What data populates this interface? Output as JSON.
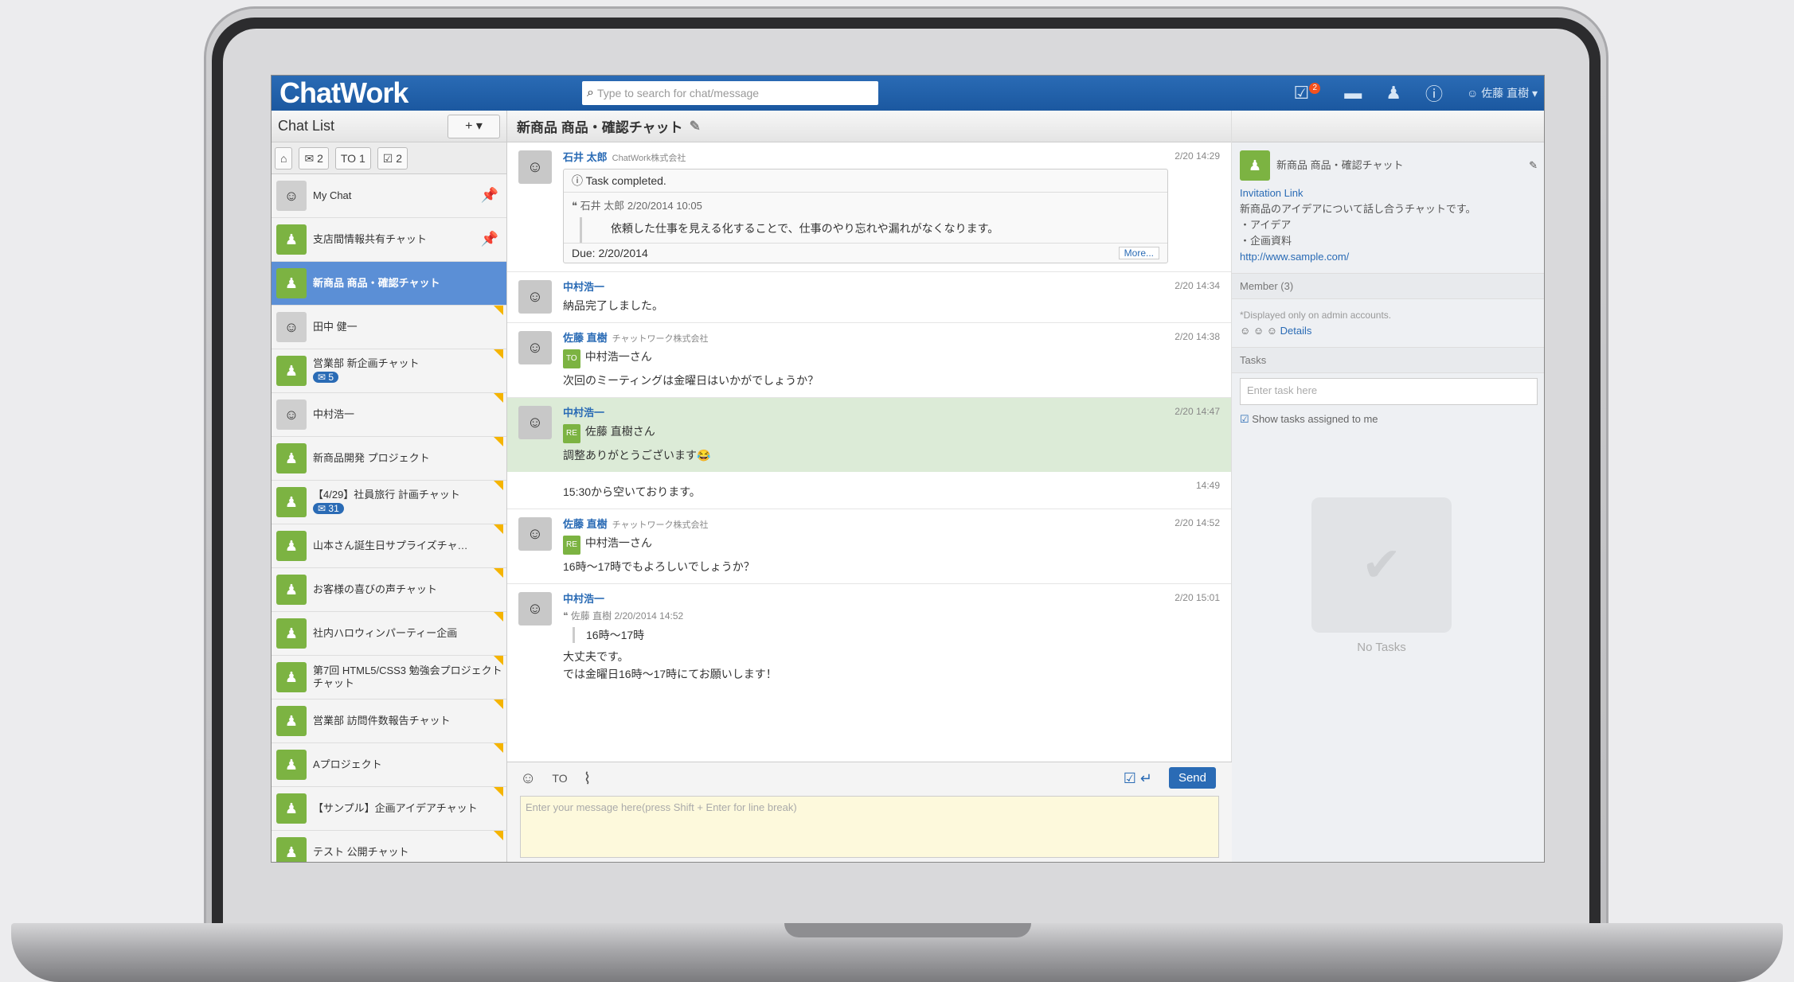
{
  "app": {
    "logo": "ChatWork"
  },
  "search": {
    "placeholder": "Type to search for chat/message"
  },
  "topbar": {
    "user_name": "佐藤 直樹"
  },
  "chat_list": {
    "title": "Chat List",
    "add_label": "+ ▾",
    "filters": [
      "⌂",
      "✉ 2",
      "TO 1",
      "☑ 2"
    ],
    "rooms": [
      {
        "name": "My Chat",
        "type": "person",
        "pinned": true
      },
      {
        "name": "支店間情報共有チャット",
        "type": "group",
        "pinned": true
      },
      {
        "name": "新商品 商品・確認チャット",
        "type": "group",
        "active": true
      },
      {
        "name": "田中 健一",
        "type": "person"
      },
      {
        "name": "営業部 新企画チャット",
        "type": "group",
        "unread": "✉ 5"
      },
      {
        "name": "中村浩一",
        "type": "person"
      },
      {
        "name": "新商品開発 プロジェクト",
        "type": "group"
      },
      {
        "name": "【4/29】社員旅行 計画チャット",
        "type": "group",
        "unread": "✉ 31"
      },
      {
        "name": "山本さん誕生日サプライズチャ…",
        "type": "group"
      },
      {
        "name": "お客様の喜びの声チャット",
        "type": "group"
      },
      {
        "name": "社内ハロウィンパーティー企画",
        "type": "group"
      },
      {
        "name": "第7回 HTML5/CSS3 勉強会プロジェクトチャット",
        "type": "group"
      },
      {
        "name": "営業部 訪問件数報告チャット",
        "type": "group"
      },
      {
        "name": "Aプロジェクト",
        "type": "group"
      },
      {
        "name": "【サンプル】企画アイデアチャット",
        "type": "group"
      },
      {
        "name": "テスト 公開チャット",
        "type": "group"
      }
    ]
  },
  "room": {
    "title": "新商品 商品・確認チャット"
  },
  "messages": [
    {
      "sender": "石井 太郎",
      "org": "ChatWork株式会社",
      "time": "2/20 14:29",
      "task_status": "ⓘ Task completed.",
      "quote_meta": "石井 太郎 2/20/2014 10:05",
      "quote_text": "依頼した仕事を見える化することで、仕事のやり忘れや漏れがなくなります。",
      "due": "Due: 2/20/2014",
      "more": "More..."
    },
    {
      "sender": "中村浩一",
      "org": "",
      "time": "2/20 14:34",
      "text": "納品完了しました。"
    },
    {
      "sender": "佐藤 直樹",
      "org": "チャットワーク株式会社",
      "time": "2/20 14:38",
      "tag": "TO",
      "to": "中村浩一さん",
      "text": "次回のミーティングは金曜日はいかがでしょうか？"
    },
    {
      "sender": "中村浩一",
      "org": "",
      "time": "2/20 14:47",
      "tag": "RE",
      "to": "佐藤 直樹さん",
      "text": "調整ありがとうございます😂",
      "follow": "15:30から空いております。",
      "follow_time": "14:49"
    },
    {
      "sender": "佐藤 直樹",
      "org": "チャットワーク株式会社",
      "time": "2/20 14:52",
      "tag": "RE",
      "to": "中村浩一さん",
      "text": "16時〜17時でもよろしいでしょうか？"
    },
    {
      "sender": "中村浩一",
      "org": "",
      "time": "2/20 15:01",
      "quote_meta": "佐藤 直樹 2/20/2014 14:52",
      "quote_text": "16時〜17時",
      "text": "大丈夫です。",
      "text2": "では金曜日16時〜17時にてお願いします！"
    }
  ],
  "composer": {
    "placeholder": "Enter your message here(press Shift + Enter for line break)",
    "send": "Send"
  },
  "info": {
    "room_title": "新商品 商品・確認チャット",
    "invitation": "Invitation Link",
    "desc1": "新商品のアイデアについて話し合うチャットです。",
    "desc2": "・アイデア",
    "desc3": "・企画資料",
    "url": "http://www.sample.com/",
    "member_title": "Member (3)",
    "member_note": "*Displayed only on admin accounts.",
    "details": "Details",
    "tasks_title": "Tasks",
    "task_placeholder": "Enter task here",
    "show_assigned": "Show tasks assigned to me",
    "no_tasks": "No Tasks"
  }
}
